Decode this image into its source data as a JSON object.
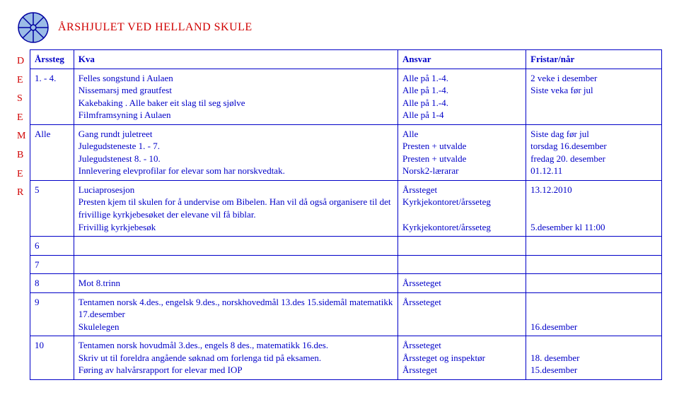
{
  "title": "ÅRSHJULET VED HELLAND SKULE",
  "rail": [
    "D",
    "E",
    "S",
    "E",
    "M",
    "B",
    "E",
    "R"
  ],
  "headers": {
    "c1": "Årssteg",
    "c2": "Kva",
    "c3": "Ansvar",
    "c4": "Fristar/når"
  },
  "rows": [
    {
      "c1": "1. - 4.",
      "c2": "Felles songstund i Aulaen\nNissemarsj med grautfest\nKakebaking . Alle baker eit slag til seg sjølve\nFilmframsyning i Aulaen",
      "c3": "Alle på 1.-4.\nAlle på 1.-4.\nAlle på 1.-4.\nAlle på 1-4",
      "c4": "2 veke i desember\nSiste veka før jul"
    },
    {
      "c1": "Alle",
      "c2": "Gang rundt juletreet\nJulegudsteneste 1. - 7.\nJulegudstenest 8. - 10.\nInnlevering elevprofilar for elevar som har norskvedtak.",
      "c3": "Alle\nPresten + utvalde\nPresten + utvalde\nNorsk2-lærarar",
      "c4": "Siste dag før jul\ntorsdag 16.desember\nfredag 20. desember\n01.12.11"
    },
    {
      "c1": "5",
      "c2": "Luciaprosesjon\nPresten kjem til skulen for å undervise om Bibelen. Han vil då også organisere til det frivillige kyrkjebesøket der elevane vil få biblar.\nFrivillig kyrkjebesøk",
      "c3": "Årssteget\nKyrkjekontoret/årsseteg\n\nKyrkjekontoret/årsseteg",
      "c4": "13.12.2010\n\n\n5.desember  kl 11:00"
    },
    {
      "c1": "6",
      "c2": "",
      "c3": "",
      "c4": ""
    },
    {
      "c1": "7",
      "c2": "",
      "c3": "",
      "c4": ""
    },
    {
      "c1": "8",
      "c2": "Mot 8.trinn",
      "c3": "Årsseteget",
      "c4": ""
    },
    {
      "c1": "9",
      "c2": "Tentamen norsk 4.des., engelsk 9.des.,  norskhovedmål 13.des 15.sidemål matematikk 17.desember\nSkulelegen",
      "c3": "Årsseteget",
      "c4": "\n\n16.desember"
    },
    {
      "c1": "10",
      "c2": "Tentamen norsk hovudmål 3.des., engels 8 des., matematikk 16.des.\nSkriv ut til foreldra angående søknad om forlenga tid på eksamen.\nFøring av halvårsrapport for elevar med IOP",
      "c3": "Årsseteget\nÅrssteget og inspektør\nÅrssteget",
      "c4": "\n18. desember\n15.desember"
    }
  ]
}
